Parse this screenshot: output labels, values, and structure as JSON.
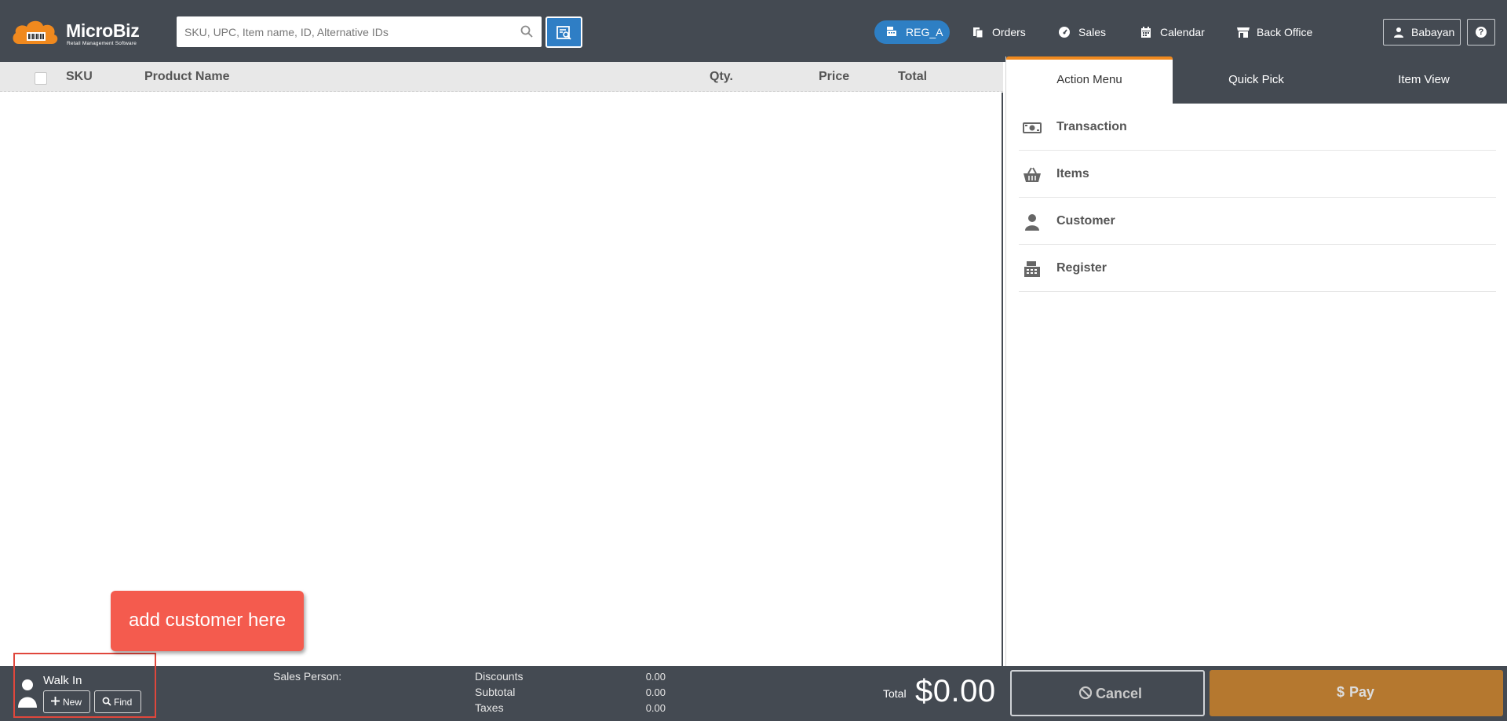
{
  "app": {
    "brand_name": "MicroBiz",
    "brand_tagline": "Retail Management Software",
    "accent_color": "#f0891e",
    "primary_blue": "#2f7ec5"
  },
  "header": {
    "search_placeholder": "SKU, UPC, Item name, ID, Alternative IDs",
    "register_label": "REG_A",
    "nav": [
      {
        "label": "Orders",
        "icon": "orders-icon"
      },
      {
        "label": "Sales",
        "icon": "dashboard-icon"
      },
      {
        "label": "Calendar",
        "icon": "calendar-icon"
      },
      {
        "label": "Back Office",
        "icon": "store-icon"
      }
    ],
    "user_label": "Babayan",
    "help_label": "?"
  },
  "cart_table": {
    "columns": [
      "SKU",
      "Product Name",
      "Qty.",
      "Price",
      "Total"
    ],
    "rows": []
  },
  "right_panel": {
    "tabs": [
      {
        "label": "Action Menu",
        "active": true
      },
      {
        "label": "Quick Pick",
        "active": false
      },
      {
        "label": "Item View",
        "active": false
      }
    ],
    "menu_items": [
      {
        "label": "Transaction",
        "icon": "money-icon"
      },
      {
        "label": "Items",
        "icon": "basket-icon"
      },
      {
        "label": "Customer",
        "icon": "person-icon"
      },
      {
        "label": "Register",
        "icon": "cash-register-icon"
      }
    ]
  },
  "footer": {
    "customer_name": "Walk In",
    "new_button_label": "New",
    "find_button_label": "Find",
    "sales_person_label": "Sales Person:",
    "summary": [
      {
        "label": "Discounts",
        "value": "0.00"
      },
      {
        "label": "Subtotal",
        "value": "0.00"
      },
      {
        "label": "Taxes",
        "value": "0.00"
      }
    ],
    "total_label": "Total",
    "total_value": "$0.00",
    "cancel_label": "Cancel",
    "pay_label": "Pay",
    "pay_color": "#b5782f"
  },
  "callout": {
    "text": "add customer here",
    "color": "#f45b4e"
  }
}
